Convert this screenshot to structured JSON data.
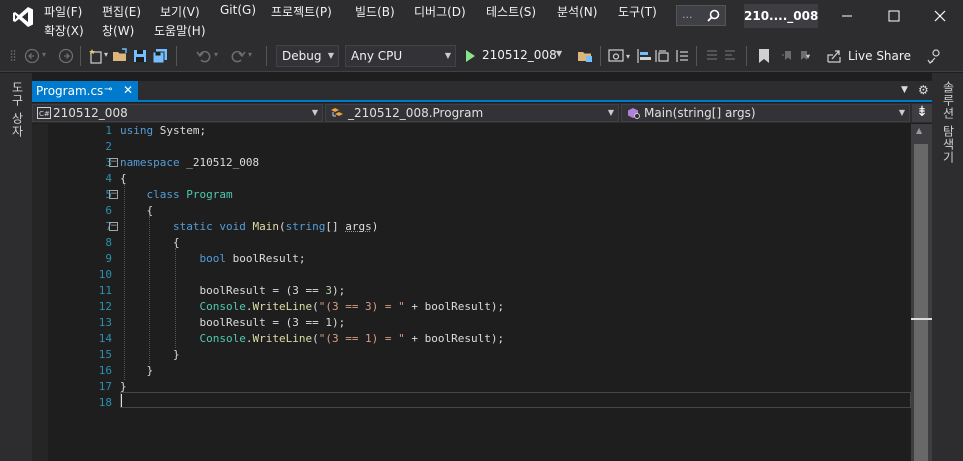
{
  "menu": {
    "row1": [
      "파일(F)",
      "편집(E)",
      "보기(V)",
      "Git(G)",
      "프로젝트(P)",
      "빌드(B)",
      "디버그(D)",
      "테스트(S)",
      "분석(N)",
      "도구(T)"
    ],
    "row2": [
      "확장(X)",
      "창(W)",
      "도움말(H)"
    ]
  },
  "search": {
    "placeholder": "..."
  },
  "solution_name": "210...._008",
  "toolbar": {
    "configuration": "Debug",
    "platform": "Any CPU",
    "run_label": "210512_008",
    "live_share_label": "Live Share"
  },
  "side": {
    "left_label": "도구 상자",
    "right_label": "솔루션 탐색기"
  },
  "tabs": [
    {
      "label": "Program.cs",
      "pin": "⊸",
      "close": "✕"
    }
  ],
  "navbar": {
    "project": "210512_008",
    "class": "_210512_008.Program",
    "member": "Main(string[] args)"
  },
  "editor": {
    "line_numbers": [
      "1",
      "2",
      "3",
      "4",
      "5",
      "6",
      "7",
      "8",
      "9",
      "10",
      "11",
      "12",
      "13",
      "14",
      "15",
      "16",
      "17",
      "18"
    ],
    "lines": {
      "l1_kw": "using",
      "l1_rest": " System;",
      "l3_kw": "namespace",
      "l3_rest": " _210512_008",
      "l4": "{",
      "l5_kw": "class",
      "l5_ty": "Program",
      "l6": "{",
      "l7_static": "static",
      "l7_void": "void",
      "l7_fn": "Main",
      "l7_p1": "(",
      "l7_type": "string",
      "l7_p2": "[] ",
      "l7_arg": "args",
      "l7_p3": ")",
      "l8": "{",
      "l9_kw": "bool",
      "l9_id": "boolResult",
      "l9_end": ";",
      "l11_id": "boolResult",
      "l11_op": " = (3 == ",
      "l11_num": "3",
      "l11_end": ");",
      "l12_ty": "Console",
      "l12_dot": ".",
      "l12_fn": "WriteLine",
      "l12_p1": "(",
      "l12_str": "\"(3 == 3) = \"",
      "l12_plus": " + ",
      "l12_id": "boolResult",
      "l12_end": ");",
      "l13_id": "boolResult",
      "l13_op": " = (3 == 1);",
      "l14_ty": "Console",
      "l14_dot": ".",
      "l14_fn": "WriteLine",
      "l14_p1": "(",
      "l14_str": "\"(3 == 1) = \"",
      "l14_plus": " + ",
      "l14_id": "boolResult",
      "l14_end": ");",
      "l15": "}",
      "l16": "}",
      "l17": "}"
    }
  },
  "colors": {
    "accent": "#007acc",
    "keyword": "#569cd6",
    "type": "#4ec9b0",
    "method": "#dcdcaa",
    "string": "#d69d85",
    "number": "#b5cea8",
    "line_number": "#2b91af"
  }
}
